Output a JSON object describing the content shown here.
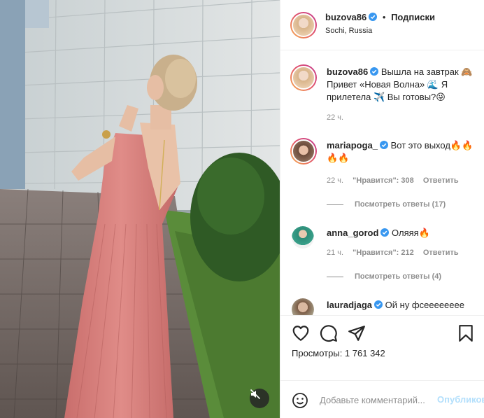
{
  "header": {
    "username": "buzova86",
    "separator": "•",
    "follow_label": "Подписки",
    "location": "Sochi, Russia"
  },
  "caption": {
    "username": "buzova86",
    "text": "Вышла на завтрак 🙈 Привет «Новая Волна» 🌊 Я прилетела ✈️ Вы готовы?😜",
    "time": "22 ч."
  },
  "comments": [
    {
      "username": "mariapoga_",
      "text": "Вот это выход🔥🔥🔥🔥",
      "time": "22 ч.",
      "likes": "\"Нравится\": 308",
      "reply": "Ответить",
      "view_replies": "Посмотреть ответы (17)"
    },
    {
      "username": "anna_gorod",
      "text": "Оляяя🔥",
      "time": "21 ч.",
      "likes": "\"Нравится\": 212",
      "reply": "Ответить",
      "view_replies": "Посмотреть ответы (4)"
    },
    {
      "username": "lauradjaga",
      "text": "Ой ну фсееееееее"
    }
  ],
  "actions": {
    "like_icon": "heart-icon",
    "comment_icon": "comment-icon",
    "share_icon": "paper-plane-icon",
    "save_icon": "bookmark-icon",
    "views": "Просмотры: 1 761 342"
  },
  "add_comment": {
    "emoji_icon": "smiley-icon",
    "placeholder": "Добавьте комментарий...",
    "publish_label": "Опубликовать"
  },
  "media": {
    "mute_icon": "speaker-muted-icon"
  },
  "colors": {
    "verified": "#3897f0",
    "link_blue_disabled": "#b2dffc",
    "dress": "#d9807d"
  }
}
